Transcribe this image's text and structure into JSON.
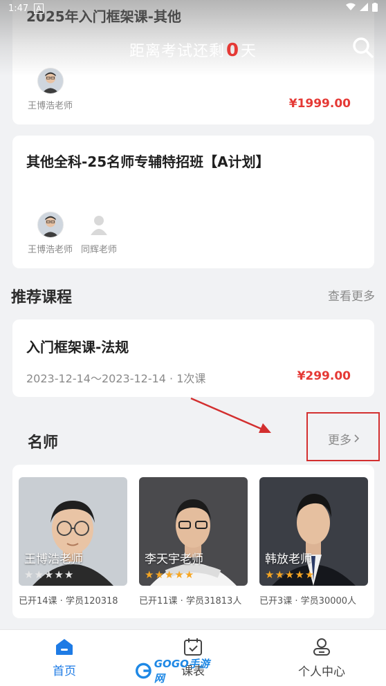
{
  "status_bar": {
    "time": "1:47"
  },
  "header": {
    "countdown_prefix": "距离考试还剩",
    "countdown_days": "0",
    "countdown_suffix": "天"
  },
  "course_cards": [
    {
      "title": "2025年入门框架课-其他",
      "teachers": [
        "王博浩老师"
      ],
      "price": "¥1999.00"
    },
    {
      "title": "其他全科-25名师专辅特招班【A计划】",
      "teachers": [
        "王博浩老师",
        "同辉老师"
      ]
    }
  ],
  "recommended": {
    "title": "推荐课程",
    "more": "查看更多",
    "course": {
      "title": "入门框架课-法规",
      "meta": "2023-12-14～2023-12-14 · 1次课",
      "price": "¥299.00"
    }
  },
  "famous_teachers": {
    "title": "名师",
    "more": "更多",
    "teachers": [
      {
        "name": "王博浩老师",
        "stats": "已开14课 · 学员120318",
        "rating": 0
      },
      {
        "name": "李天宇老师",
        "stats": "已开11课 · 学员31813人",
        "rating": 5
      },
      {
        "name": "韩放老师",
        "stats": "已开3课 · 学员30000人",
        "rating": 5
      }
    ]
  },
  "tabbar": {
    "tabs": [
      {
        "label": "首页",
        "icon": "home-icon",
        "active": true
      },
      {
        "label": "课表",
        "icon": "calendar-icon",
        "active": false
      },
      {
        "label": "个人中心",
        "icon": "profile-icon",
        "active": false
      }
    ]
  },
  "watermark": {
    "text": "GOGO手游网"
  },
  "colors": {
    "accent": "#1e7be5",
    "price": "#e53935",
    "star": "#f6a623",
    "annotation": "#d32f2f"
  }
}
